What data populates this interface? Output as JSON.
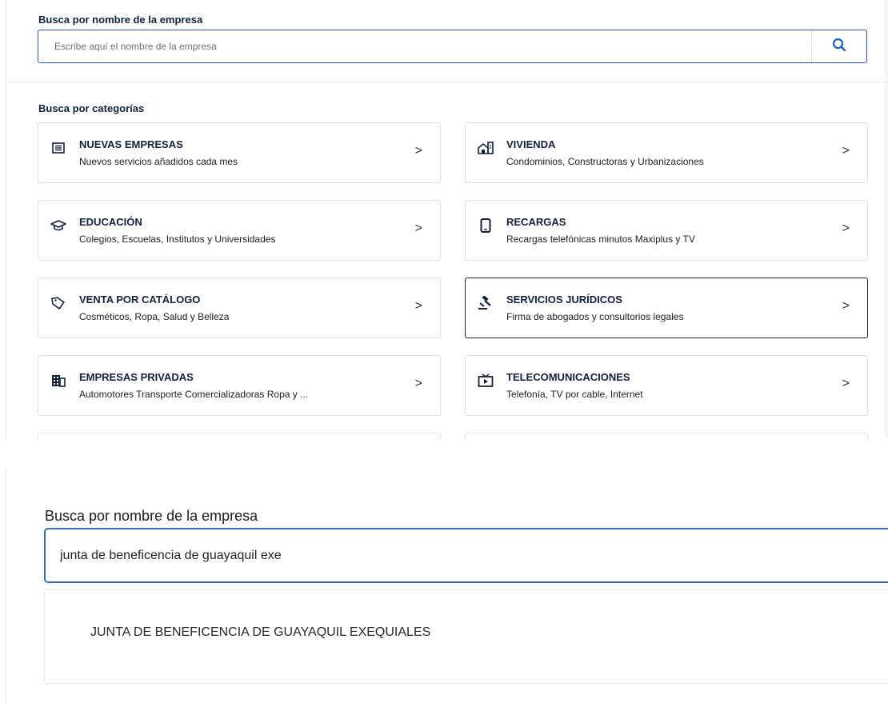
{
  "panel1": {
    "search": {
      "label": "Busca por nombre de la empresa",
      "placeholder": "Escribe aquí el nombre de la empresa",
      "button_icon": "search-icon"
    },
    "categories_label": "Busca por categorías",
    "categories": [
      {
        "title": "NUEVAS EMPRESAS",
        "subtitle": "Nuevos servicios añadidos cada mes",
        "icon": "list-icon"
      },
      {
        "title": "VIVIENDA",
        "subtitle": "Condominios, Constructoras y Urbanizaciones",
        "icon": "building-house-icon"
      },
      {
        "title": "EDUCACIÓN",
        "subtitle": "Colegios, Escuelas, Institutos y Universidades",
        "icon": "graduation-cap-icon"
      },
      {
        "title": "RECARGAS",
        "subtitle": "Recargas telefónicas minutos Maxiplus y TV",
        "icon": "mobile-phone-icon"
      },
      {
        "title": "VENTA POR CATÁLOGO",
        "subtitle": "Cosméticos, Ropa, Salud y Belleza",
        "icon": "tag-icon"
      },
      {
        "title": "SERVICIOS JURÍDICOS",
        "subtitle": "Firma de abogados y consultorios legales",
        "icon": "gavel-icon"
      },
      {
        "title": "EMPRESAS PRIVADAS",
        "subtitle": "Automotores Transporte Comercializadoras Ropa y ...",
        "icon": "office-building-icon"
      },
      {
        "title": "TELECOMUNICACIONES",
        "subtitle": "Telefonía, TV por cable, Internet",
        "icon": "tv-icon"
      }
    ],
    "chevron": ">"
  },
  "panel2": {
    "label": "Busca por nombre de la empresa",
    "input_value": "junta de beneficencia de guayaquil exe",
    "result": "JUNTA DE BENEFICENCIA DE GUAYAQUIL EXEQUIALES"
  },
  "colors": {
    "title_navy": "#14213d",
    "input_border": "#2a5ca8",
    "search_icon": "#1f5fb8",
    "card_border": "#dfe2e6"
  }
}
